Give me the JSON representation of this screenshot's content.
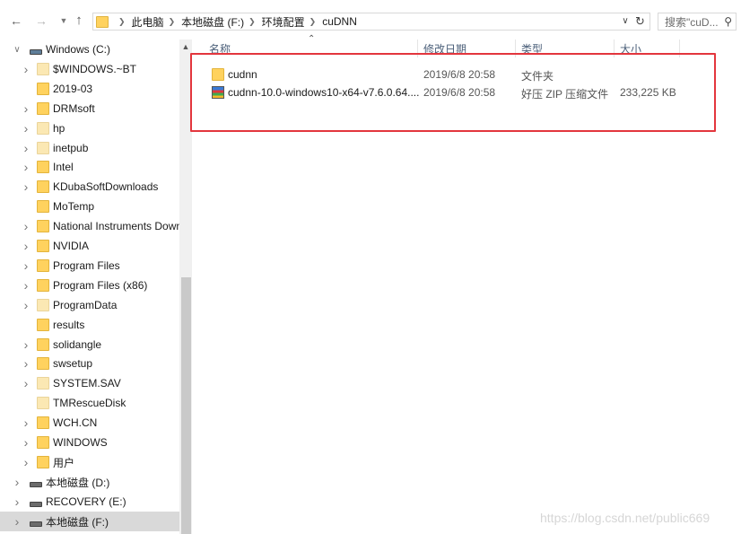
{
  "breadcrumb": [
    "此电脑",
    "本地磁盘 (F:)",
    "环境配置",
    "cuDNN"
  ],
  "search": {
    "placeholder": "搜索\"cuD..."
  },
  "icons": {
    "back": "back-arrow-icon",
    "forward": "forward-arrow-icon",
    "recent": "recent-locations-chevron-icon",
    "up": "up-arrow-icon",
    "refresh": "refresh-icon",
    "search": "search-icon",
    "folder": "folder-icon",
    "drive": "drive-icon",
    "zip": "zip-archive-icon"
  },
  "nav": {
    "root": {
      "label": "Windows (C:)",
      "expanded": true
    },
    "folders": [
      {
        "label": "$WINDOWS.~BT",
        "expandable": true,
        "hidden": true
      },
      {
        "label": "2019-03",
        "expandable": false,
        "hidden": false
      },
      {
        "label": "DRMsoft",
        "expandable": true,
        "hidden": false
      },
      {
        "label": "hp",
        "expandable": true,
        "hidden": true
      },
      {
        "label": "inetpub",
        "expandable": true,
        "hidden": true
      },
      {
        "label": "Intel",
        "expandable": true,
        "hidden": false
      },
      {
        "label": "KDubaSoftDownloads",
        "expandable": true,
        "hidden": false
      },
      {
        "label": "MoTemp",
        "expandable": false,
        "hidden": false
      },
      {
        "label": "National Instruments Downl",
        "expandable": true,
        "hidden": false
      },
      {
        "label": "NVIDIA",
        "expandable": true,
        "hidden": false
      },
      {
        "label": "Program Files",
        "expandable": true,
        "hidden": false
      },
      {
        "label": "Program Files (x86)",
        "expandable": true,
        "hidden": false
      },
      {
        "label": "ProgramData",
        "expandable": true,
        "hidden": true
      },
      {
        "label": "results",
        "expandable": false,
        "hidden": false
      },
      {
        "label": "solidangle",
        "expandable": true,
        "hidden": false
      },
      {
        "label": "swsetup",
        "expandable": true,
        "hidden": false
      },
      {
        "label": "SYSTEM.SAV",
        "expandable": true,
        "hidden": true
      },
      {
        "label": "TMRescueDisk",
        "expandable": false,
        "hidden": true
      },
      {
        "label": "WCH.CN",
        "expandable": true,
        "hidden": false
      },
      {
        "label": "WINDOWS",
        "expandable": true,
        "hidden": false
      },
      {
        "label": "用户",
        "expandable": true,
        "hidden": false
      }
    ],
    "drives": [
      {
        "label": "本地磁盘 (D:)",
        "selected": false
      },
      {
        "label": "RECOVERY (E:)",
        "selected": false
      },
      {
        "label": "本地磁盘 (F:)",
        "selected": true
      }
    ]
  },
  "columns": {
    "name": "名称",
    "date": "修改日期",
    "type": "类型",
    "size": "大小"
  },
  "files": [
    {
      "name": "cudnn",
      "date": "2019/6/8 20:58",
      "type": "文件夹",
      "size": "",
      "icon": "folder-icon"
    },
    {
      "name": "cudnn-10.0-windows10-x64-v7.6.0.64....",
      "date": "2019/6/8 20:58",
      "type": "好压 ZIP 压缩文件",
      "size": "233,225 KB",
      "icon": "zip-archive-icon"
    }
  ],
  "watermark": "https://blog.csdn.net/public669",
  "colors": {
    "highlight": "#e3363d",
    "folder": "#ffd25e",
    "selection": "#d9d9d9"
  }
}
